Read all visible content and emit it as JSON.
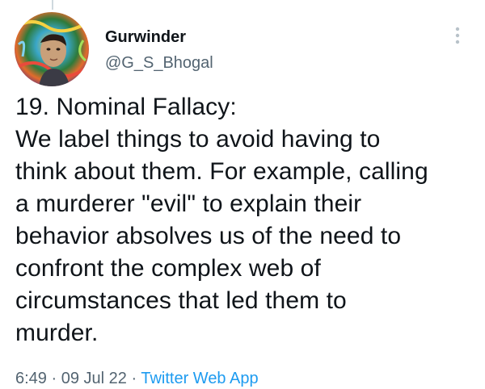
{
  "author": {
    "display_name": "Gurwinder",
    "handle": "@G_S_Bhogal"
  },
  "tweet": {
    "lines": [
      "19. Nominal Fallacy:",
      "We label things to avoid having to",
      "think about them. For example, calling",
      "a murderer \"evil\" to explain their",
      "behavior absolves us of the need to",
      "confront the complex web of",
      "circumstances that led them to",
      "murder."
    ],
    "time": "6:49",
    "separator": "·",
    "date": "09 Jul 22",
    "source": "Twitter Web App"
  },
  "icons": {
    "more": "more-vertical-icon",
    "avatar": "avatar"
  },
  "colors": {
    "text": "#0f1419",
    "secondary": "#536471",
    "link": "#1d9bf0"
  }
}
